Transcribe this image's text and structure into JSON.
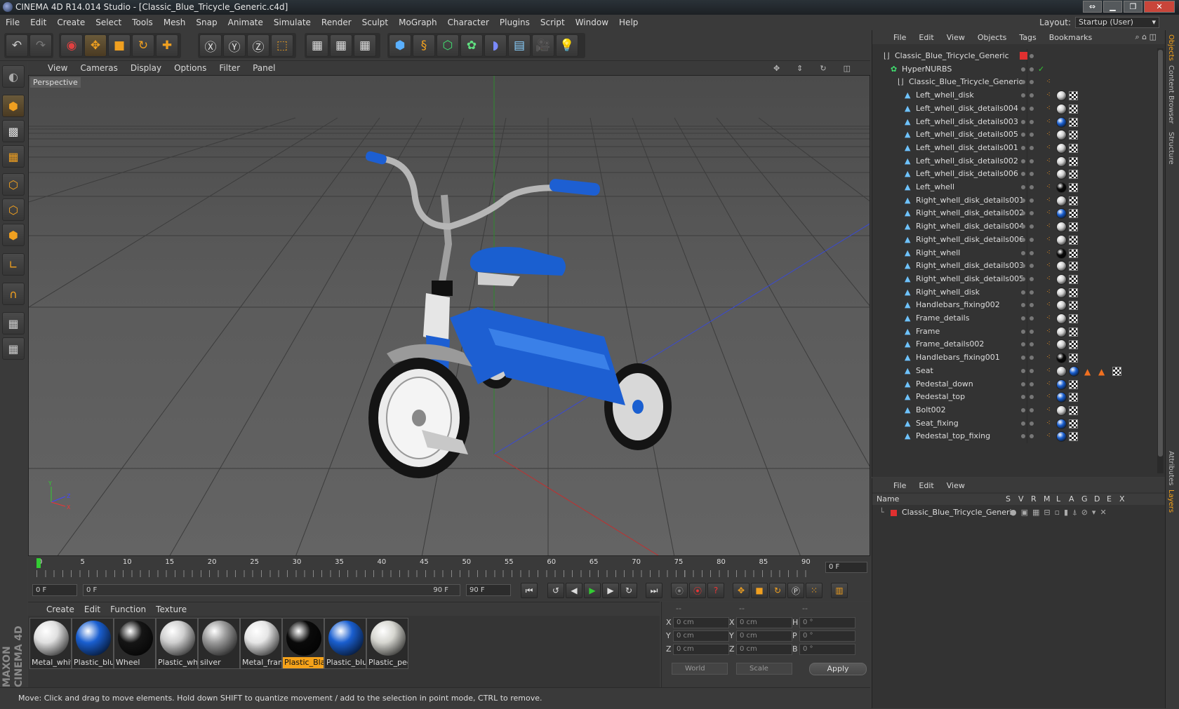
{
  "window": {
    "title": "CINEMA 4D R14.014 Studio - [Classic_Blue_Tricycle_Generic.c4d]"
  },
  "menubar": [
    "File",
    "Edit",
    "Create",
    "Select",
    "Tools",
    "Mesh",
    "Snap",
    "Animate",
    "Simulate",
    "Render",
    "Sculpt",
    "MoGraph",
    "Character",
    "Plugins",
    "Script",
    "Window",
    "Help"
  ],
  "layout": {
    "label": "Layout:",
    "value": "Startup (User)"
  },
  "viewport": {
    "menu": [
      "View",
      "Cameras",
      "Display",
      "Options",
      "Filter",
      "Panel"
    ],
    "label": "Perspective"
  },
  "timeline": {
    "ticks": [
      "0",
      "5",
      "10",
      "15",
      "20",
      "25",
      "30",
      "35",
      "40",
      "45",
      "50",
      "55",
      "60",
      "65",
      "70",
      "75",
      "80",
      "85",
      "90"
    ],
    "current": "0 F"
  },
  "transport": {
    "start": "0 F",
    "range_start": "0 F",
    "range_end": "90 F",
    "end": "90 F"
  },
  "materials": {
    "menu": [
      "Create",
      "Edit",
      "Function",
      "Texture"
    ],
    "items": [
      {
        "name": "Metal_whit",
        "color": "#e0e0e0",
        "selected": false
      },
      {
        "name": "Plastic_blu",
        "color": "#1a5fd0",
        "selected": false
      },
      {
        "name": "Wheel",
        "color": "#151515",
        "selected": false
      },
      {
        "name": "Plastic_whi",
        "color": "#cfcfcf",
        "selected": false
      },
      {
        "name": "silver",
        "color": "#9a9a9a",
        "selected": false
      },
      {
        "name": "Metal_fram",
        "color": "#e6e6e6",
        "selected": false
      },
      {
        "name": "Plastic_Blac",
        "color": "#0a0a0a",
        "selected": true
      },
      {
        "name": "Plastic_blu",
        "color": "#1a5fd0",
        "selected": false
      },
      {
        "name": "Plastic_ped",
        "color": "#d6d6d0",
        "selected": false
      }
    ]
  },
  "coords": {
    "head": [
      "--",
      "--",
      "--"
    ],
    "rows": [
      {
        "a": "X",
        "av": "0 cm",
        "b": "X",
        "bv": "0 cm",
        "c": "H",
        "cv": "0 °"
      },
      {
        "a": "Y",
        "av": "0 cm",
        "b": "Y",
        "bv": "0 cm",
        "c": "P",
        "cv": "0 °"
      },
      {
        "a": "Z",
        "av": "0 cm",
        "b": "Z",
        "bv": "0 cm",
        "c": "B",
        "cv": "0 °"
      }
    ],
    "world": "World",
    "scale": "Scale",
    "apply": "Apply"
  },
  "status": "Move: Click and drag to move elements. Hold down SHIFT to quantize movement / add to the selection in point mode, CTRL to remove.",
  "objects": {
    "menu": [
      "File",
      "Edit",
      "View",
      "Objects",
      "Tags",
      "Bookmarks"
    ],
    "rows": [
      {
        "name": "Classic_Blue_Tricycle_Generic",
        "level": 0,
        "icon": "L0",
        "tag": "red"
      },
      {
        "name": "HyperNURBS",
        "level": 1,
        "icon": "H",
        "tag": "check"
      },
      {
        "name": "Classic_Blue_Tricycle_Generic",
        "level": 2,
        "icon": "L0",
        "tag": "none"
      },
      {
        "name": "Left_whell_disk",
        "level": 3,
        "icon": "▲",
        "tag": "grey"
      },
      {
        "name": "Left_whell_disk_details004",
        "level": 3,
        "icon": "▲",
        "tag": "grey"
      },
      {
        "name": "Left_whell_disk_details003",
        "level": 3,
        "icon": "▲",
        "tag": "blue"
      },
      {
        "name": "Left_whell_disk_details005",
        "level": 3,
        "icon": "▲",
        "tag": "grey"
      },
      {
        "name": "Left_whell_disk_details001",
        "level": 3,
        "icon": "▲",
        "tag": "grey"
      },
      {
        "name": "Left_whell_disk_details002",
        "level": 3,
        "icon": "▲",
        "tag": "grey"
      },
      {
        "name": "Left_whell_disk_details006",
        "level": 3,
        "icon": "▲",
        "tag": "grey"
      },
      {
        "name": "Left_whell",
        "level": 3,
        "icon": "▲",
        "tag": "black"
      },
      {
        "name": "Right_whell_disk_details001",
        "level": 3,
        "icon": "▲",
        "tag": "grey"
      },
      {
        "name": "Right_whell_disk_details002",
        "level": 3,
        "icon": "▲",
        "tag": "blue"
      },
      {
        "name": "Right_whell_disk_details004",
        "level": 3,
        "icon": "▲",
        "tag": "grey"
      },
      {
        "name": "Right_whell_disk_details006",
        "level": 3,
        "icon": "▲",
        "tag": "grey"
      },
      {
        "name": "Right_whell",
        "level": 3,
        "icon": "▲",
        "tag": "black"
      },
      {
        "name": "Right_whell_disk_details003",
        "level": 3,
        "icon": "▲",
        "tag": "grey"
      },
      {
        "name": "Right_whell_disk_details005",
        "level": 3,
        "icon": "▲",
        "tag": "grey"
      },
      {
        "name": "Right_whell_disk",
        "level": 3,
        "icon": "▲",
        "tag": "grey"
      },
      {
        "name": "Handlebars_fixing002",
        "level": 3,
        "icon": "▲",
        "tag": "grey"
      },
      {
        "name": "Frame_details",
        "level": 3,
        "icon": "▲",
        "tag": "grey"
      },
      {
        "name": "Frame",
        "level": 3,
        "icon": "▲",
        "tag": "grey"
      },
      {
        "name": "Frame_details002",
        "level": 3,
        "icon": "▲",
        "tag": "grey"
      },
      {
        "name": "Handlebars_fixing001",
        "level": 3,
        "icon": "▲",
        "tag": "black"
      },
      {
        "name": "Seat",
        "level": 3,
        "icon": "▲",
        "tag": "seat"
      },
      {
        "name": "Pedestal_down",
        "level": 3,
        "icon": "▲",
        "tag": "blue"
      },
      {
        "name": "Pedestal_top",
        "level": 3,
        "icon": "▲",
        "tag": "blue"
      },
      {
        "name": "Bolt002",
        "level": 3,
        "icon": "▲",
        "tag": "grey"
      },
      {
        "name": "Seat_fixing",
        "level": 3,
        "icon": "▲",
        "tag": "blue"
      },
      {
        "name": "Pedestal_top_fixing",
        "level": 3,
        "icon": "▲",
        "tag": "blue"
      }
    ]
  },
  "attributes": {
    "menu": [
      "File",
      "Edit",
      "View"
    ],
    "headers": [
      "Name",
      "S",
      "V",
      "R",
      "M",
      "L",
      "A",
      "G",
      "D",
      "E",
      "X"
    ],
    "layer": "Classic_Blue_Tricycle_Generic"
  },
  "sidetabs": [
    "Objects",
    "Content Browser",
    "Structure",
    "Attributes",
    "Layers"
  ],
  "colors": {
    "accent": "#f5a21a",
    "blue": "#1a5fd0"
  }
}
